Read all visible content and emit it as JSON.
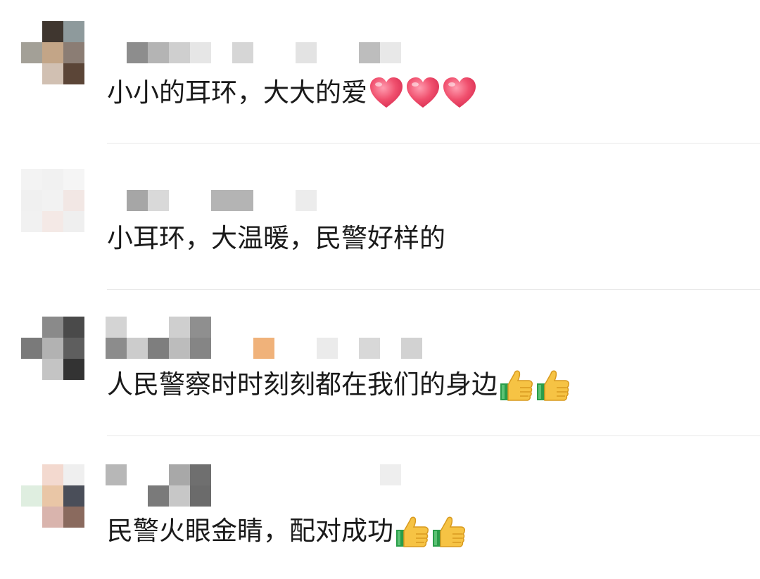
{
  "comments": [
    {
      "text": "小小的耳环，大大的爱",
      "emojis": [
        "heart-icon",
        "heart-icon",
        "heart-icon"
      ]
    },
    {
      "text": "小耳环，大温暖，民警好样的",
      "emojis": []
    },
    {
      "text": "人民警察时时刻刻都在我们的身边",
      "emojis": [
        "thumbs-up-icon",
        "thumbs-up-icon"
      ]
    },
    {
      "text": "民警火眼金睛，配对成功",
      "emojis": [
        "thumbs-up-icon",
        "thumbs-up-icon"
      ]
    }
  ],
  "colors": {
    "text": "#1a1a1a",
    "divider": "#e9e9e9",
    "heart": "#f0506e",
    "thumb": "#f6c344",
    "cuff": "#2a9d4a"
  }
}
